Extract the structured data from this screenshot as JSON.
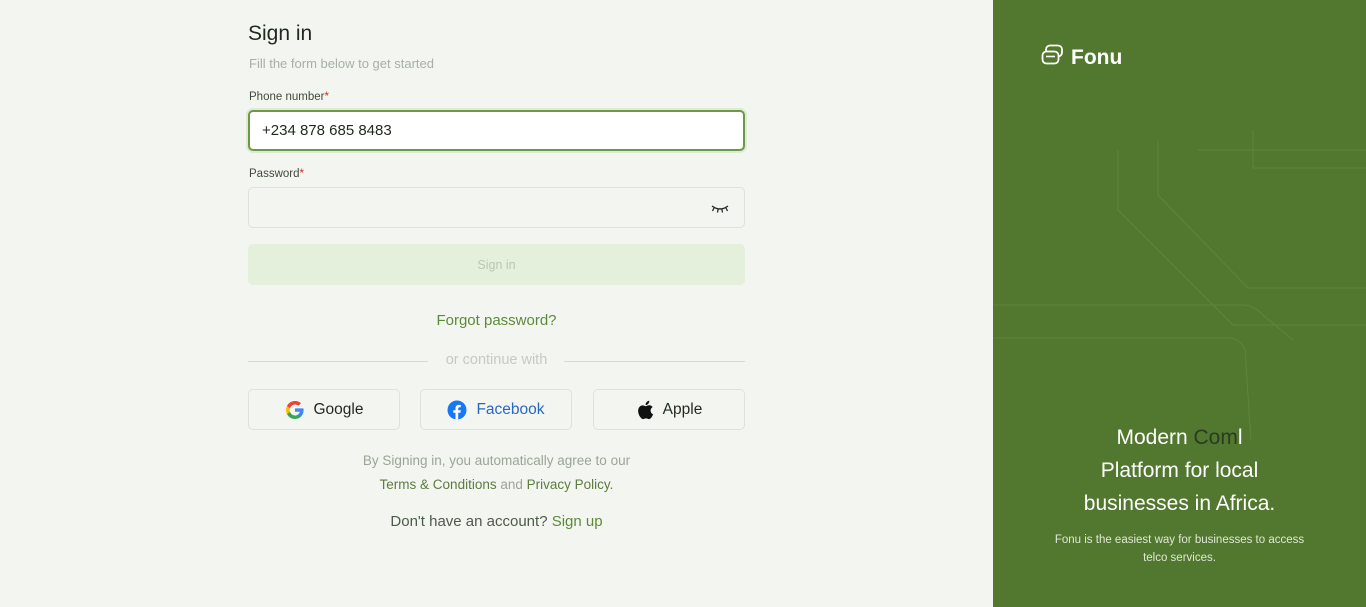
{
  "form": {
    "title": "Sign in",
    "subtitle": "Fill the form below to get started",
    "phone_label": "Phone number",
    "phone_value": "+234 878 685 8483",
    "password_label": "Password",
    "password_value": "",
    "required_mark": "*",
    "submit_label": "Sign in",
    "forgot_label": "Forgot password?",
    "divider_text": "or continue with"
  },
  "social": {
    "google": "Google",
    "facebook": "Facebook",
    "apple": "Apple"
  },
  "legal": {
    "prefix": "By Signing in, you automatically agree to our",
    "terms": "Terms & Conditions",
    "and": "and",
    "privacy": "Privacy Policy."
  },
  "signup": {
    "prompt": "Don't have an account?",
    "link": "Sign up"
  },
  "brand_panel": {
    "logo_text": "Fonu",
    "headline_part1": "Modern ",
    "headline_typed": "Com",
    "headline_cursor": "l",
    "headline_line2": "Platform for local",
    "headline_line3": "businesses in Africa.",
    "description": "Fonu is the easiest way for businesses to access telco services."
  },
  "colors": {
    "brand_green": "#52782f",
    "accent_green": "#5d8a3a",
    "background": "#f3f6f0",
    "facebook_blue": "#2a67c3",
    "required_red": "#d02b2b"
  },
  "icons": {
    "password_toggle": "eye-closed-icon",
    "google": "google-icon",
    "facebook": "facebook-icon",
    "apple": "apple-icon",
    "logo": "fonu-logo-icon"
  }
}
